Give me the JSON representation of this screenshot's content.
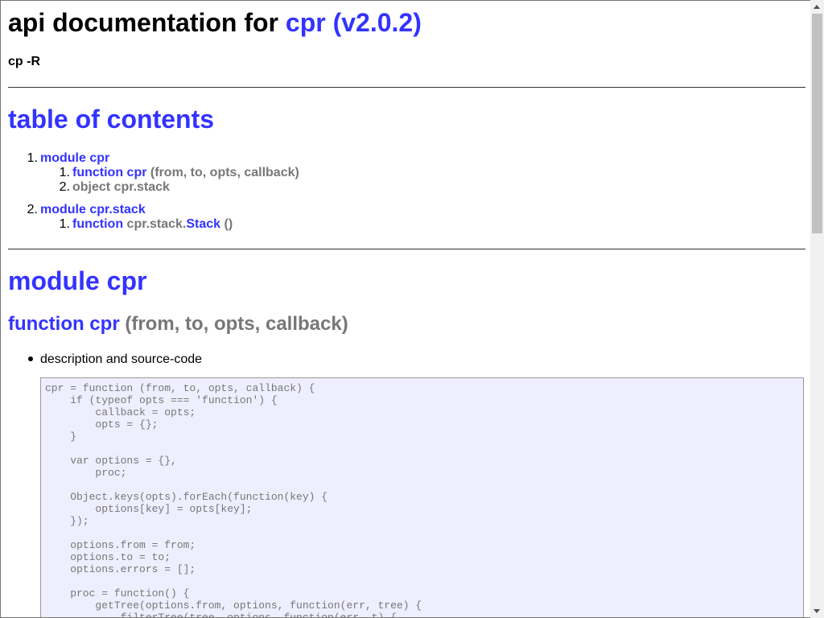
{
  "header": {
    "title_prefix": "api documentation for ",
    "title_link": "cpr (v2.0.2)",
    "subtitle": "cp -R"
  },
  "toc": {
    "heading": "table of contents",
    "items": [
      {
        "num": "1.",
        "label": "module cpr",
        "children": [
          {
            "num": "1.",
            "kind": "function",
            "name": "cpr",
            "signature": "(from, to, opts, callback)"
          },
          {
            "num": "2.",
            "label": "object cpr.stack"
          }
        ]
      },
      {
        "num": "2.",
        "label": "module cpr.stack",
        "children": [
          {
            "num": "1.",
            "kind": "function",
            "prefix": "cpr.stack.",
            "name": "Stack",
            "signature": "()"
          }
        ]
      }
    ]
  },
  "module": {
    "heading": "module cpr",
    "function_kind": "function cpr",
    "function_signature": "(from, to, opts, callback)",
    "bullet": "description and source-code",
    "code": "cpr = function (from, to, opts, callback) {\n    if (typeof opts === 'function') {\n        callback = opts;\n        opts = {};\n    }\n\n    var options = {},\n        proc;\n\n    Object.keys(opts).forEach(function(key) {\n        options[key] = opts[key];\n    });\n\n    options.from = from;\n    options.to = to;\n    options.errors = [];\n\n    proc = function() {\n        getTree(options.from, options, function(err, tree) {\n            filterTree(tree, options, function(err, t) {"
  }
}
